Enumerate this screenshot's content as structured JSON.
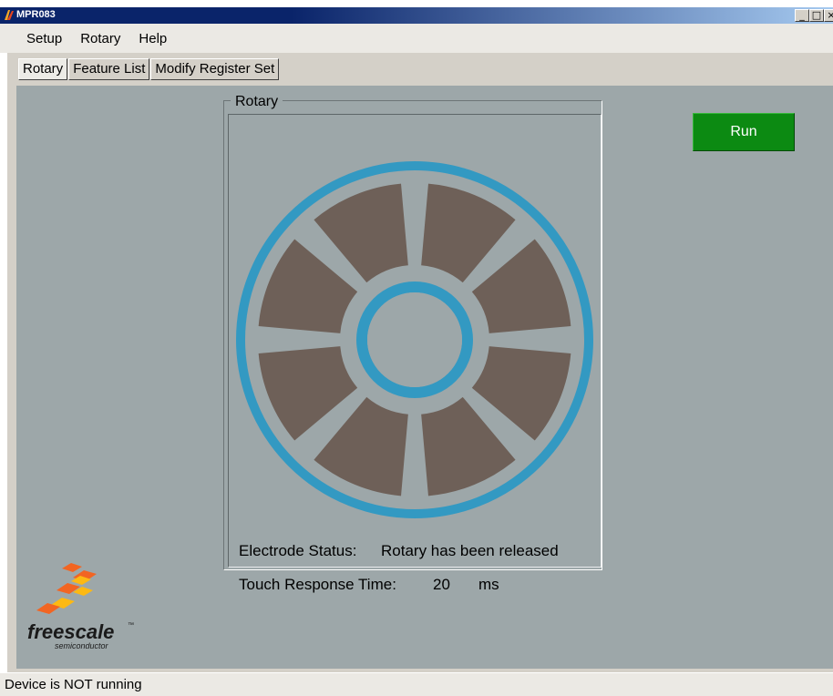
{
  "window": {
    "title": "MPR083",
    "minimize_glyph": "_",
    "maximize_glyph": "□",
    "close_glyph": "×"
  },
  "menu": {
    "items": [
      "Setup",
      "Rotary",
      "Help"
    ]
  },
  "tabs": [
    {
      "label": "Rotary",
      "active": true
    },
    {
      "label": "Feature List",
      "active": false
    },
    {
      "label": "Modify Register Set",
      "active": false
    }
  ],
  "rotary_panel": {
    "group_label": "Rotary",
    "electrode_status_label": "Electrode Status:",
    "electrode_status_value": "Rotary has been released",
    "segment_count": 8,
    "colors": {
      "ring": "#3399c2",
      "segment": "#6e6058",
      "background": "#9da7a9"
    }
  },
  "touch_response": {
    "label": "Touch Response Time:",
    "value": "20",
    "unit": "ms"
  },
  "run_button": {
    "label": "Run",
    "color": "#0c8a12"
  },
  "logo": {
    "wordmark": "freescale",
    "trademark": "™",
    "subtext": "semiconductor"
  },
  "statusbar": {
    "text": "Device is NOT running"
  }
}
